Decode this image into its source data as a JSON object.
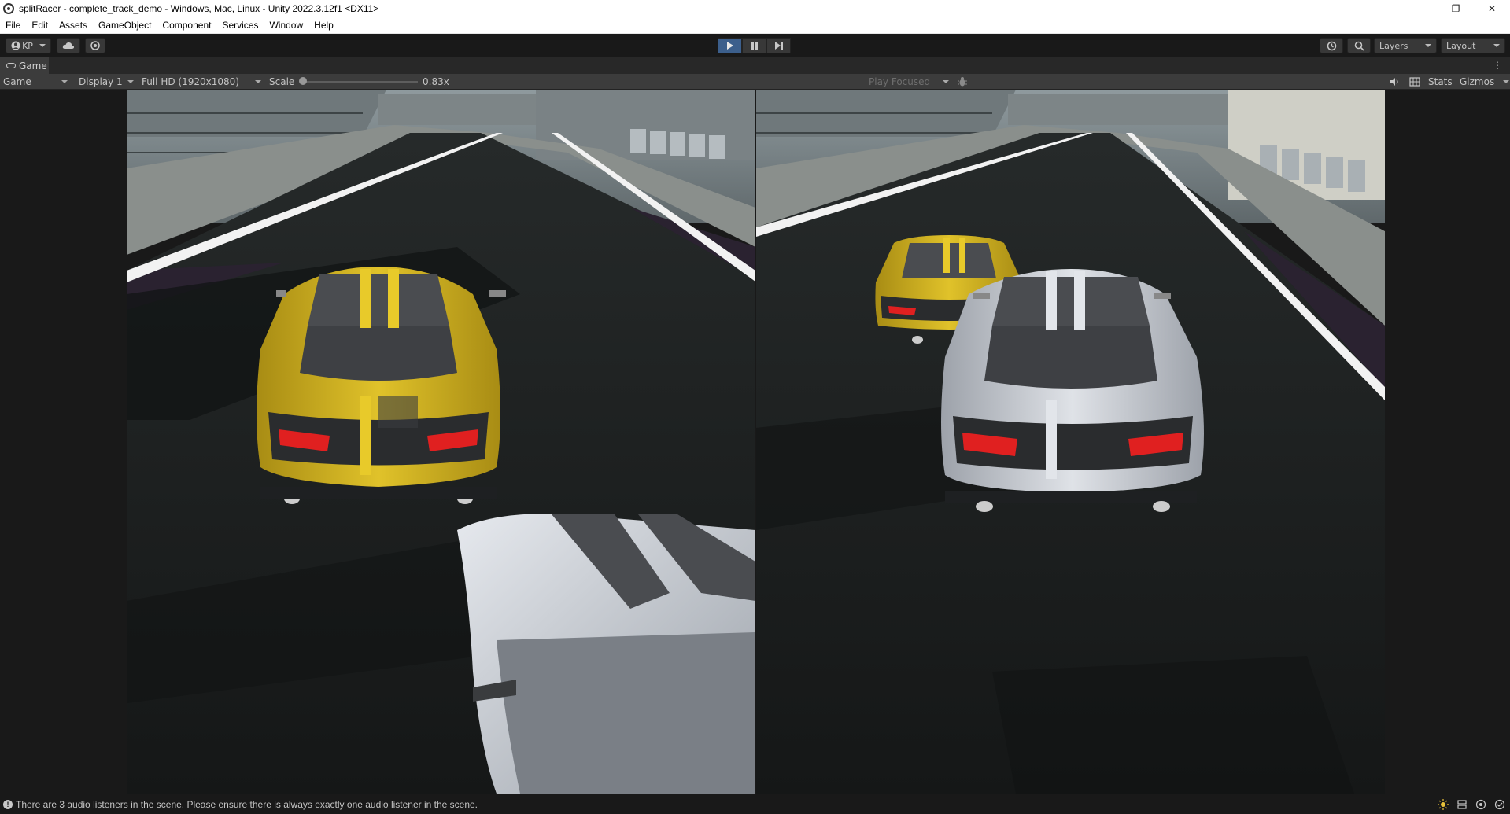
{
  "window": {
    "title": "splitRacer - complete_track_demo - Windows, Mac, Linux - Unity 2022.3.12f1 <DX11>",
    "minimize": "—",
    "restore": "❐",
    "close": "✕"
  },
  "menu": [
    "File",
    "Edit",
    "Assets",
    "GameObject",
    "Component",
    "Services",
    "Window",
    "Help"
  ],
  "toolbar": {
    "account": "KP",
    "layers": "Layers",
    "layout": "Layout",
    "icons": [
      "account-icon",
      "cloud-icon",
      "collab-icon",
      "play-icon",
      "pause-icon",
      "step-icon",
      "history-icon",
      "search-icon"
    ]
  },
  "game_tab": {
    "label": "Game"
  },
  "game_bar": {
    "view_mode": "Game",
    "display": "Display 1",
    "resolution": "Full HD (1920x1080)",
    "scale_label": "Scale",
    "scale_value": "0.83x",
    "scale_fraction": 0.0,
    "play_mode": "Play Focused",
    "stats": "Stats",
    "gizmos": "Gizmos"
  },
  "status": {
    "message": "There are 3 audio listeners in the scene. Please ensure there is always exactly one audio listener in the scene."
  },
  "colors": {
    "accent": "#3c5f8c",
    "editor_bg": "#191919",
    "panel_bg": "#3c3c3c",
    "asphalt": "#1b1e1e",
    "yellow_car": "#d6b41e",
    "white_car": "#c8ccd2",
    "taillight": "#e02020"
  }
}
